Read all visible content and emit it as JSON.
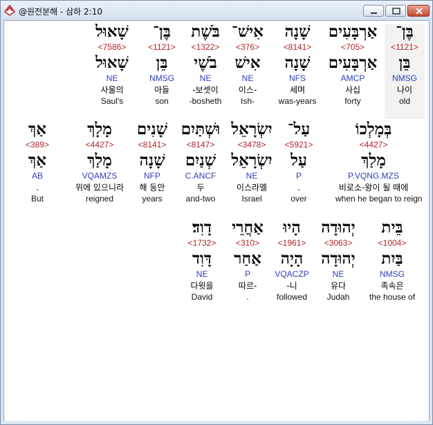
{
  "window": {
    "title": "@원전분해 - 삼하 2:10"
  },
  "rows": [
    {
      "words": [
        {
          "heb": "בֶּן־",
          "strong": "<1121>",
          "heb_lemma": "בֵּן",
          "morph": "NMSG",
          "kor": "나이",
          "eng": "old"
        },
        {
          "heb": "אַרְבָּעִים",
          "strong": "<705>",
          "heb_lemma": "אַרְבָּעִים",
          "morph": "AMCP",
          "kor": "사십",
          "eng": "forty"
        },
        {
          "heb": "שָׁנָה",
          "strong": "<8141>",
          "heb_lemma": "שָׁנָה",
          "morph": "NFS",
          "kor": "세며",
          "eng": "was-years"
        },
        {
          "heb": "אִישׁ־",
          "strong": "<376>",
          "heb_lemma": "אִישׁ",
          "morph": "NE",
          "kor": "이스-",
          "eng": "Ish-"
        },
        {
          "heb": "בֹּשֶׁת",
          "strong": "<1322>",
          "heb_lemma": "בֹשֶׁי",
          "morph": "NE",
          "kor": "-보셋이",
          "eng": "-bosheth"
        },
        {
          "heb": "בֶּן־",
          "strong": "<1121>",
          "heb_lemma": "בֵּן",
          "morph": "NMSG",
          "kor": "아들",
          "eng": "son"
        },
        {
          "heb": "שָׁאוּל",
          "strong": "<7586>",
          "heb_lemma": "שָׁאוּל",
          "morph": "NE",
          "kor": "사울의",
          "eng": "Saul's"
        }
      ]
    },
    {
      "words": [
        {
          "heb": "בְּמָלְכוֹ",
          "strong": "<4427>",
          "heb_lemma": "מָלַךְ",
          "morph": "P.VQNG.MZS",
          "kor": "비로소-왕이 될 때에",
          "eng": "when he began to reign"
        },
        {
          "heb": "עַל־",
          "strong": "<5921>",
          "heb_lemma": "עַל",
          "morph": "P",
          "kor": ".",
          "eng": "over"
        },
        {
          "heb": "יִשְׂרָאֵל",
          "strong": "<3478>",
          "heb_lemma": "יִשְׂרָאֵל",
          "morph": "NE",
          "kor": "이스라엘",
          "eng": "Israel"
        },
        {
          "heb": "וּשְׁתַּיִם",
          "strong": "<8147>",
          "heb_lemma": "שְׁנַיִם",
          "morph": "C.ANCF",
          "kor": "두",
          "eng": "and-two"
        },
        {
          "heb": "שָׁנִים",
          "strong": "<8141>",
          "heb_lemma": "שָׁנָה",
          "morph": "NFP",
          "kor": "해 동안",
          "eng": "years"
        },
        {
          "heb": "מָלָךְ",
          "strong": "<4427>",
          "heb_lemma": "מָלַךְ",
          "morph": "VQAMZS",
          "kor": "위에 있으니라",
          "eng": "reigned"
        },
        {
          "heb": "אַךְ",
          "strong": "<389>",
          "heb_lemma": "אַךְ",
          "morph": "AB",
          "kor": ".",
          "eng": "But"
        }
      ]
    },
    {
      "words": [
        {
          "heb": "בֵּית",
          "strong": "<1004>",
          "heb_lemma": "בַּיִת",
          "morph": "NMSG",
          "kor": "족속은",
          "eng": "the house of"
        },
        {
          "heb": "יְהוּדָה",
          "strong": "<3063>",
          "heb_lemma": "יְהוּדָה",
          "morph": "NE",
          "kor": "유다",
          "eng": "Judah"
        },
        {
          "heb": "הָיוּ",
          "strong": "<1961>",
          "heb_lemma": "הָיָה",
          "morph": "VQACZP",
          "kor": "-니",
          "eng": "followed"
        },
        {
          "heb": "אַחֲרֵי",
          "strong": "<310>",
          "heb_lemma": "אַחַר",
          "morph": "P",
          "kor": "따르-",
          "eng": "."
        },
        {
          "heb": "דָוִד׃",
          "strong": "<1732>",
          "heb_lemma": "דָּוִד",
          "morph": "NE",
          "kor": "다윗을",
          "eng": "David"
        }
      ]
    }
  ]
}
